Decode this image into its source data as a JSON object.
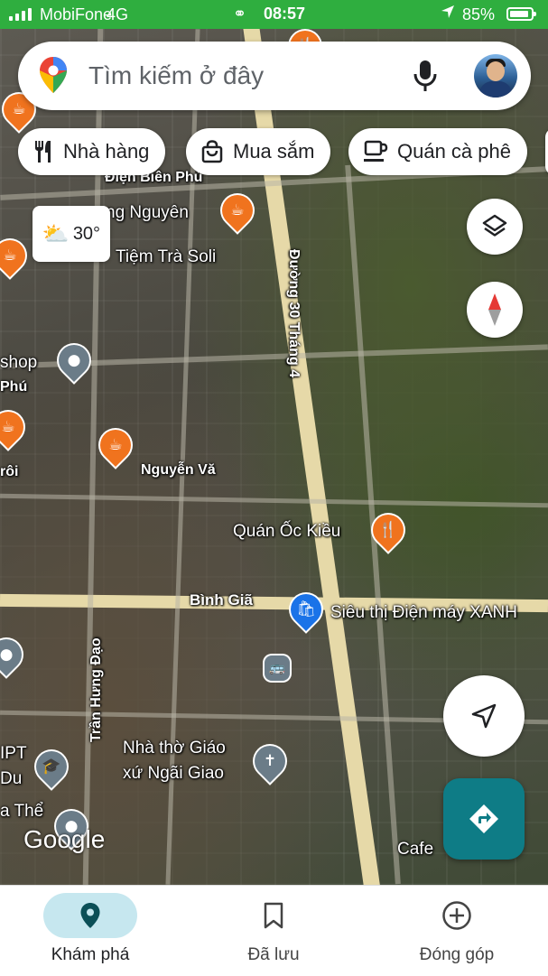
{
  "status_bar": {
    "carrier": "MobiFone",
    "network": "4G",
    "time": "08:57",
    "battery": "85%"
  },
  "search": {
    "placeholder": "Tìm kiếm ở đây"
  },
  "chips": [
    {
      "label": "Nhà hàng",
      "icon": "fork-knife-icon"
    },
    {
      "label": "Mua sắm",
      "icon": "shopping-bag-icon"
    },
    {
      "label": "Quán cà phê",
      "icon": "coffee-cup-icon"
    }
  ],
  "weather": {
    "temperature": "30°",
    "icon": "partly-cloudy-icon"
  },
  "map": {
    "labels": {
      "dien_bien_phu": "Điện Biên Phủ",
      "duong_30_thang_4": "Đường 30 Tháng 4",
      "nguyen": "ng Nguyên",
      "tiem_tra_soli": "Tiệm Trà Soli",
      "shop": "shop",
      "phu": "Phú",
      "roi": "rôi",
      "nguyen_van": "Nguyễn Vă",
      "quan_oc_kieu": "Quán Ốc Kiều",
      "binh_gia": "Bình Giã",
      "sieu_thi": "Siêu thị Điện máy XANH",
      "tran_hung_dao": "Trần Hưng Đạo",
      "nha_tho_1": "Nhà thờ Giáo",
      "nha_tho_2": "xứ Ngãi Giao",
      "ipt": "IPT",
      "du": "Du",
      "a_the": "a Thể",
      "cafe": "Cafe"
    },
    "attribution": "Google"
  },
  "bottom_nav": [
    {
      "label": "Khám phá",
      "icon": "location-pin-icon",
      "active": true
    },
    {
      "label": "Đã lưu",
      "icon": "bookmark-icon",
      "active": false
    },
    {
      "label": "Đóng góp",
      "icon": "add-circle-icon",
      "active": false
    }
  ],
  "colors": {
    "status_bar": "#2fae3f",
    "directions_button": "#0e7c86",
    "active_nav_pill": "#c6e7ef",
    "food_pin": "#f0731e",
    "road": "#e6d9a8"
  }
}
